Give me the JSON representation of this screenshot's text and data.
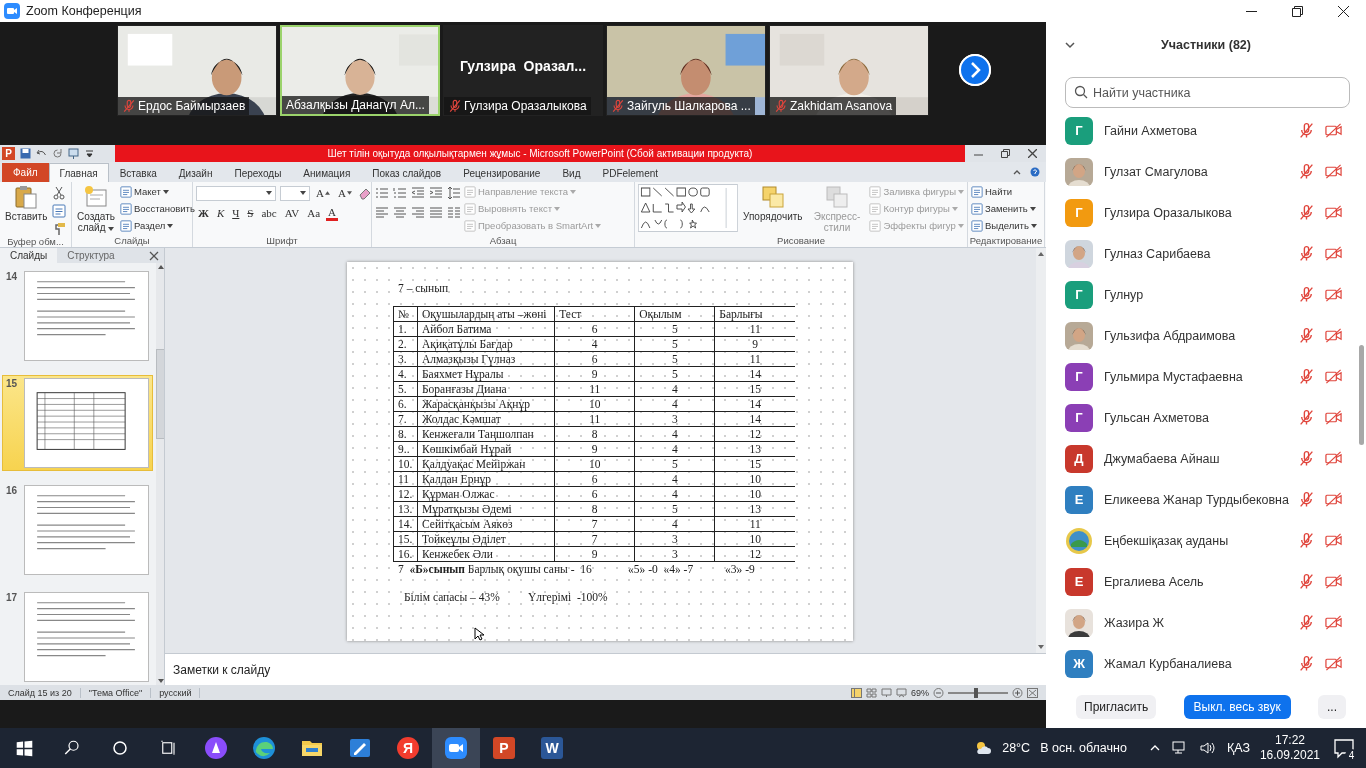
{
  "window": {
    "title": "Zoom Конференция"
  },
  "videos": [
    {
      "kind": "video",
      "name": "Ердос Баймырзаев",
      "muted": true,
      "active": false
    },
    {
      "kind": "video",
      "name": "Абзалқызы Данагүл Ал...",
      "muted": false,
      "active": true
    },
    {
      "kind": "name",
      "display_name": "Гулзира  Оразал...",
      "name": "Гулзира Оразалыкова",
      "muted": true,
      "active": false
    },
    {
      "kind": "video",
      "name": "Зайгуль Шалкарова ...",
      "muted": true,
      "active": false
    },
    {
      "kind": "video",
      "name": "Zakhidam Asanova",
      "muted": true,
      "active": false
    }
  ],
  "powerpoint": {
    "app_glyph": "P",
    "title": "Шет тілін оқытуда олқылықтармен  жұмыс  -  Microsoft PowerPoint (Сбой активации продукта)",
    "file_tab": "Файл",
    "tabs": [
      {
        "label": "Главная",
        "selected": true
      },
      {
        "label": "Вставка",
        "selected": false
      },
      {
        "label": "Дизайн",
        "selected": false
      },
      {
        "label": "Переходы",
        "selected": false
      },
      {
        "label": "Анимация",
        "selected": false
      },
      {
        "label": "Показ слайдов",
        "selected": false
      },
      {
        "label": "Рецензирование",
        "selected": false
      },
      {
        "label": "Вид",
        "selected": false
      },
      {
        "label": "PDFelement",
        "selected": false
      }
    ],
    "ribbon": [
      {
        "kind": "clipboard",
        "label": "Буфер обм...",
        "large": [
          {
            "label": "Вставить",
            "disabled": false,
            "dropdown": false
          }
        ]
      },
      {
        "kind": "slides",
        "label": "Слайды",
        "large": [
          {
            "label": "Создать слайд",
            "disabled": false,
            "dropdown": true
          }
        ],
        "small": [
          {
            "label": "Макет",
            "disabled": false,
            "dropdown": true
          },
          {
            "label": "Восстановить",
            "disabled": false,
            "dropdown": false
          },
          {
            "label": "Раздел",
            "disabled": false,
            "dropdown": true
          }
        ]
      },
      {
        "kind": "font",
        "label": "Шрифт",
        "size_glyphs": [
          "A",
          "A"
        ],
        "glyphs": [
          "Ж",
          "К",
          "Ч",
          "S",
          "abc",
          "AV",
          "Aa",
          "A"
        ]
      },
      {
        "kind": "paragraph",
        "label": "Абзац",
        "small": [
          {
            "label": "Направление текста",
            "disabled": true,
            "dropdown": true
          },
          {
            "label": "Выровнять текст",
            "disabled": true,
            "dropdown": true
          },
          {
            "label": "Преобразовать в SmartArt",
            "disabled": true,
            "dropdown": true
          }
        ]
      },
      {
        "kind": "drawing",
        "label": "Рисование",
        "large": [
          {
            "label": "Упорядочить",
            "disabled": false,
            "dropdown": false
          },
          {
            "label": "Экспресс-стили",
            "disabled": true,
            "dropdown": false
          }
        ],
        "small": [
          {
            "label": "Заливка фигуры",
            "disabled": true,
            "dropdown": true
          },
          {
            "label": "Контур фигуры",
            "disabled": true,
            "dropdown": true
          },
          {
            "label": "Эффекты фигур",
            "disabled": true,
            "dropdown": true
          }
        ]
      },
      {
        "kind": "editing",
        "label": "Редактирование",
        "small": [
          {
            "label": "Найти",
            "disabled": false,
            "dropdown": false
          },
          {
            "label": "Заменить",
            "disabled": false,
            "dropdown": true
          },
          {
            "label": "Выделить",
            "disabled": false,
            "dropdown": true
          }
        ]
      }
    ],
    "pane_tabs": [
      {
        "label": "Слайды",
        "selected": true
      },
      {
        "label": "Структура",
        "selected": false
      }
    ],
    "thumbnails": [
      {
        "number": "14",
        "selected": false
      },
      {
        "number": "15",
        "selected": true
      },
      {
        "number": "16",
        "selected": false
      },
      {
        "number": "17",
        "selected": false
      }
    ],
    "slide": {
      "heading": "7 – сынып",
      "columns": [
        "№",
        "Оқушылардың аты –жөні",
        "Тест",
        "Оқылым",
        "Барлығы"
      ],
      "rows": [
        [
          "1.",
          "Айбол Батима",
          "6",
          "5",
          "11"
        ],
        [
          "2.",
          "Ақиқатұлы Бағдар",
          "4",
          "5",
          "9"
        ],
        [
          "3.",
          "Алмазқызы Гүлназ",
          "6",
          "5",
          "11"
        ],
        [
          "4.",
          "Баяхмет Нұралы",
          "9",
          "5",
          "14"
        ],
        [
          "5.",
          "Боранғазы Диана",
          "11",
          "4",
          "15"
        ],
        [
          "6.",
          "Жарасқанқызы Ақнұр",
          "10",
          "4",
          "14"
        ],
        [
          "7.",
          "Жолдас Кәмшат",
          "11",
          "3",
          "14"
        ],
        [
          "8.",
          "Кенжеғали Таңшолпан",
          "8",
          "4",
          "12"
        ],
        [
          "9..",
          "Көшкімбай Нұрай",
          "9",
          "4",
          "13"
        ],
        [
          "10.",
          "Қалдуақас Мейіржан",
          "10",
          "5",
          "15"
        ],
        [
          "11",
          "Қалдан Ернұр",
          "6",
          "4",
          "10"
        ],
        [
          "12.",
          "Құрман Олжас",
          "6",
          "4",
          "10"
        ],
        [
          "13.",
          "Мұратқызы Әдемі",
          "8",
          "5",
          "13"
        ],
        [
          "14.",
          "Сейітқасым Аякөз",
          "7",
          "4",
          "11"
        ],
        [
          "15.",
          "Тойкеұлы Әділет",
          "7",
          "3",
          "10"
        ],
        [
          "16.",
          "Кенжебек Әли",
          "9",
          "3",
          "12"
        ]
      ],
      "summary": [
        "7  **«Б»сынып** Барлық оқушы саны -  16",
        "«5» -0  «4» -7",
        "«3» -9"
      ],
      "results": [
        "Білім сапасы – 43%",
        "Үлгерімі  -100%"
      ]
    },
    "notes": {
      "placeholder": "Заметки к слайду"
    },
    "status_bar": {
      "items": [
        "Слайд 15 из 20",
        "\"Тема Office\"",
        "русский"
      ],
      "zoom": "69%",
      "level": 0.47
    }
  },
  "participants_panel": {
    "title": "Участники (82)",
    "search": {
      "placeholder": "Найти участника"
    },
    "participants": [
      {
        "kind": "letter",
        "initial": "Г",
        "color": "#1a9e7c",
        "name": "Гайни Ахметова",
        "muted": true,
        "video_off": true
      },
      {
        "name": "Гулзат Смагулова",
        "muted": true,
        "video_off": true
      },
      {
        "kind": "letter",
        "initial": "Г",
        "color": "#f29a10",
        "name": "Гулзира Оразалыкова",
        "muted": true,
        "video_off": true
      },
      {
        "name": "Гулназ Сарибаева",
        "muted": true,
        "video_off": true
      },
      {
        "kind": "letter",
        "initial": "Г",
        "color": "#1a9e7c",
        "name": "Гулнур",
        "muted": true,
        "video_off": true
      },
      {
        "name": "Гульзифа Абдраимова",
        "muted": true,
        "video_off": true
      },
      {
        "kind": "letter",
        "initial": "Г",
        "color": "#8b3fb5",
        "name": "Гульмира Мустафаевна",
        "muted": true,
        "video_off": true
      },
      {
        "kind": "letter",
        "initial": "Г",
        "color": "#8b3fb5",
        "name": "Гульсан Ахметова",
        "muted": true,
        "video_off": true
      },
      {
        "kind": "letter",
        "initial": "Д",
        "color": "#c8382c",
        "name": "Джумабаева Айнаш",
        "muted": true,
        "video_off": true
      },
      {
        "kind": "letter",
        "initial": "Е",
        "color": "#2f7fc0",
        "name": "Еликеева Жанар Турдыбековна",
        "muted": true,
        "video_off": true
      },
      {
        "kind": "emblem",
        "name": "Еңбекшіқазақ ауданы",
        "muted": true,
        "video_off": true
      },
      {
        "kind": "letter",
        "initial": "Е",
        "color": "#c8382c",
        "name": "Ергалиева Асель",
        "muted": true,
        "video_off": true
      },
      {
        "name": "Жазира Ж",
        "muted": true,
        "video_off": true
      },
      {
        "kind": "letter",
        "initial": "Ж",
        "color": "#2f7fc0",
        "name": "Жамал Курбаналиева",
        "muted": true,
        "video_off": true
      }
    ],
    "buttons": [
      {
        "kind": "secondary",
        "label": "Пригласить"
      },
      {
        "kind": "primary",
        "label": "Выкл. весь звук"
      },
      {
        "kind": "more",
        "label": "..."
      }
    ]
  },
  "taskbar": {
    "apps": [
      {
        "kind": "start",
        "selected": false
      },
      {
        "kind": "search",
        "selected": false
      },
      {
        "kind": "cortana",
        "selected": false
      },
      {
        "kind": "taskview",
        "selected": false
      },
      {
        "kind": "alice",
        "selected": false
      },
      {
        "kind": "edge",
        "selected": false
      },
      {
        "kind": "explorer",
        "selected": false
      },
      {
        "kind": "editor",
        "selected": false
      },
      {
        "kind": "yandex",
        "glyph": "Я",
        "selected": false
      },
      {
        "kind": "zoom",
        "selected": true
      },
      {
        "kind": "powerpoint",
        "glyph": "P",
        "selected": false
      },
      {
        "kind": "word",
        "glyph": "W",
        "selected": false
      }
    ],
    "temperature": "28°C",
    "weather": "В осн. облачно",
    "language": "ҚАЗ",
    "time": "17:22",
    "date": "16.09.2021",
    "notifications": "4"
  }
}
